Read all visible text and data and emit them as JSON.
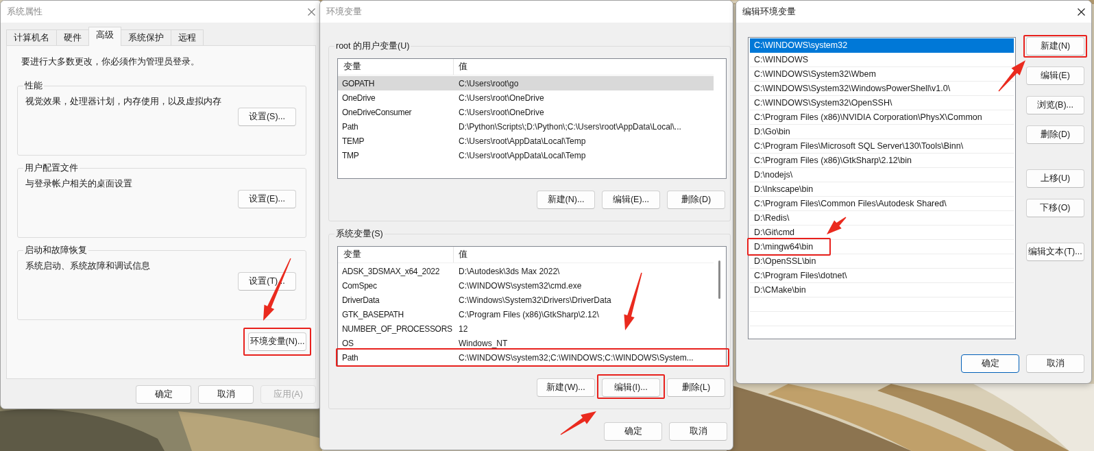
{
  "system_properties": {
    "title": "系统属性",
    "active": false,
    "tabs": [
      {
        "label": "计算机名",
        "selected": false
      },
      {
        "label": "硬件",
        "selected": false
      },
      {
        "label": "高级",
        "selected": true
      },
      {
        "label": "系统保护",
        "selected": false
      },
      {
        "label": "远程",
        "selected": false
      }
    ],
    "notice": "要进行大多数更改，你必须作为管理员登录。",
    "groups": [
      {
        "title": "性能",
        "description": "视觉效果，处理器计划，内存使用，以及虚拟内存",
        "button": "设置(S)..."
      },
      {
        "title": "用户配置文件",
        "description": "与登录帐户相关的桌面设置",
        "button": "设置(E)..."
      },
      {
        "title": "启动和故障恢复",
        "description": "系统启动、系统故障和调试信息",
        "button": "设置(T)..."
      }
    ],
    "env_button": {
      "label": "环境变量(N)...",
      "highlighted": true
    },
    "buttons": [
      {
        "label": "确定",
        "disabled": false
      },
      {
        "label": "取消",
        "disabled": false
      },
      {
        "label": "应用(A)",
        "disabled": true
      }
    ]
  },
  "environment_variables": {
    "title": "环境变量",
    "active": false,
    "user_variables": {
      "title": "root 的用户变量(U)",
      "columns": [
        "变量",
        "值"
      ],
      "rows": [
        {
          "name": "GOPATH",
          "value": "C:\\Users\\root\\go",
          "selected": true,
          "highlighted": false
        },
        {
          "name": "OneDrive",
          "value": "C:\\Users\\root\\OneDrive",
          "selected": false,
          "highlighted": false
        },
        {
          "name": "OneDriveConsumer",
          "value": "C:\\Users\\root\\OneDrive",
          "selected": false,
          "highlighted": false
        },
        {
          "name": "Path",
          "value": "D:\\Python\\Scripts\\;D:\\Python\\;C:\\Users\\root\\AppData\\Local\\...",
          "selected": false,
          "highlighted": false
        },
        {
          "name": "TEMP",
          "value": "C:\\Users\\root\\AppData\\Local\\Temp",
          "selected": false,
          "highlighted": false
        },
        {
          "name": "TMP",
          "value": "C:\\Users\\root\\AppData\\Local\\Temp",
          "selected": false,
          "highlighted": false
        }
      ],
      "buttons": [
        {
          "label": "新建(N)...",
          "highlighted": false
        },
        {
          "label": "编辑(E)...",
          "highlighted": false
        },
        {
          "label": "删除(D)",
          "highlighted": false
        }
      ]
    },
    "system_variables": {
      "title": "系统变量(S)",
      "columns": [
        "变量",
        "值"
      ],
      "rows": [
        {
          "name": "ADSK_3DSMAX_x64_2022",
          "value": "D:\\Autodesk\\3ds Max 2022\\",
          "selected": false,
          "highlighted": false
        },
        {
          "name": "ComSpec",
          "value": "C:\\WINDOWS\\system32\\cmd.exe",
          "selected": false,
          "highlighted": false
        },
        {
          "name": "DriverData",
          "value": "C:\\Windows\\System32\\Drivers\\DriverData",
          "selected": false,
          "highlighted": false
        },
        {
          "name": "GTK_BASEPATH",
          "value": "C:\\Program Files (x86)\\GtkSharp\\2.12\\",
          "selected": false,
          "highlighted": false
        },
        {
          "name": "NUMBER_OF_PROCESSORS",
          "value": "12",
          "selected": false,
          "highlighted": false
        },
        {
          "name": "OS",
          "value": "Windows_NT",
          "selected": false,
          "highlighted": false
        },
        {
          "name": "Path",
          "value": "C:\\WINDOWS\\system32;C:\\WINDOWS;C:\\WINDOWS\\System...",
          "selected": false,
          "highlighted": true
        }
      ],
      "buttons": [
        {
          "label": "新建(W)...",
          "highlighted": false
        },
        {
          "label": "编辑(I)...",
          "highlighted": true
        },
        {
          "label": "删除(L)",
          "highlighted": false
        }
      ]
    },
    "buttons": [
      {
        "label": "确定"
      },
      {
        "label": "取消"
      }
    ]
  },
  "edit_environment_variable": {
    "title": "编辑环境变量",
    "active": true,
    "entries": [
      {
        "text": "C:\\WINDOWS\\system32",
        "selected": true,
        "highlighted": false
      },
      {
        "text": "C:\\WINDOWS",
        "selected": false,
        "highlighted": false
      },
      {
        "text": "C:\\WINDOWS\\System32\\Wbem",
        "selected": false,
        "highlighted": false
      },
      {
        "text": "C:\\WINDOWS\\System32\\WindowsPowerShell\\v1.0\\",
        "selected": false,
        "highlighted": false
      },
      {
        "text": "C:\\WINDOWS\\System32\\OpenSSH\\",
        "selected": false,
        "highlighted": false
      },
      {
        "text": "C:\\Program Files (x86)\\NVIDIA Corporation\\PhysX\\Common",
        "selected": false,
        "highlighted": false
      },
      {
        "text": "D:\\Go\\bin",
        "selected": false,
        "highlighted": false
      },
      {
        "text": "C:\\Program Files\\Microsoft SQL Server\\130\\Tools\\Binn\\",
        "selected": false,
        "highlighted": false
      },
      {
        "text": "C:\\Program Files (x86)\\GtkSharp\\2.12\\bin",
        "selected": false,
        "highlighted": false
      },
      {
        "text": "D:\\nodejs\\",
        "selected": false,
        "highlighted": false
      },
      {
        "text": "D:\\Inkscape\\bin",
        "selected": false,
        "highlighted": false
      },
      {
        "text": "C:\\Program Files\\Common Files\\Autodesk Shared\\",
        "selected": false,
        "highlighted": false
      },
      {
        "text": "D:\\Redis\\",
        "selected": false,
        "highlighted": false
      },
      {
        "text": "D:\\Git\\cmd",
        "selected": false,
        "highlighted": false
      },
      {
        "text": "D:\\mingw64\\bin",
        "selected": false,
        "highlighted": true
      },
      {
        "text": "D:\\OpenSSL\\bin",
        "selected": false,
        "highlighted": false
      },
      {
        "text": "C:\\Program Files\\dotnet\\",
        "selected": false,
        "highlighted": false
      },
      {
        "text": "D:\\CMake\\bin",
        "selected": false,
        "highlighted": false
      }
    ],
    "side_button_groups": [
      [
        {
          "label": "新建(N)",
          "highlighted": true
        },
        {
          "label": "编辑(E)",
          "highlighted": false
        },
        {
          "label": "浏览(B)...",
          "highlighted": false
        },
        {
          "label": "删除(D)",
          "highlighted": false
        }
      ],
      [
        {
          "label": "上移(U)",
          "highlighted": false
        },
        {
          "label": "下移(O)",
          "highlighted": false
        }
      ],
      [
        {
          "label": "编辑文本(T)...",
          "highlighted": false
        }
      ]
    ],
    "buttons": [
      {
        "label": "确定",
        "default": true
      },
      {
        "label": "取消",
        "default": false
      }
    ]
  }
}
